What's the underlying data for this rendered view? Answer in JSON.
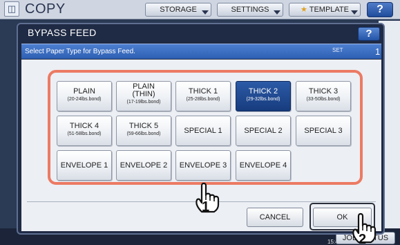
{
  "background": {
    "title": "COPY",
    "tabs": [
      {
        "label": "STORAGE"
      },
      {
        "label": "SETTINGS"
      },
      {
        "label": "TEMPLATE"
      }
    ],
    "help": "?",
    "time": "15:45",
    "jobs_label": "JOB STATUS"
  },
  "dialog": {
    "title": "BYPASS FEED",
    "help": "?",
    "instruction": "Select Paper Type for Bypass Feed.",
    "set_label": "SET",
    "set_value": "1",
    "selected": "THICK 2",
    "paper_types": [
      {
        "label": "PLAIN",
        "sub": "(20-24lbs.bond)"
      },
      {
        "label": "PLAIN",
        "label2": "(THIN)",
        "sub": "(17-19lbs.bond)"
      },
      {
        "label": "THICK 1",
        "sub": "(25-28lbs.bond)"
      },
      {
        "label": "THICK 2",
        "sub": "(29-32lbs.bond)"
      },
      {
        "label": "THICK 3",
        "sub": "(33-50lbs.bond)"
      },
      {
        "label": "THICK 4",
        "sub": "(51-58lbs.bond)"
      },
      {
        "label": "THICK 5",
        "sub": "(59-66lbs.bond)"
      },
      {
        "label": "SPECIAL 1"
      },
      {
        "label": "SPECIAL 2"
      },
      {
        "label": "SPECIAL 3"
      },
      {
        "label": "ENVELOPE 1"
      },
      {
        "label": "ENVELOPE 2"
      },
      {
        "label": "ENVELOPE 3"
      },
      {
        "label": "ENVELOPE 4"
      }
    ],
    "cancel_label": "CANCEL",
    "ok_label": "OK"
  },
  "callouts": {
    "step1": "1",
    "step2": "2"
  },
  "colors": {
    "highlight": "#ec7a63",
    "selected_button": "#1f4c94",
    "info_bar": "#3a6cc0"
  }
}
